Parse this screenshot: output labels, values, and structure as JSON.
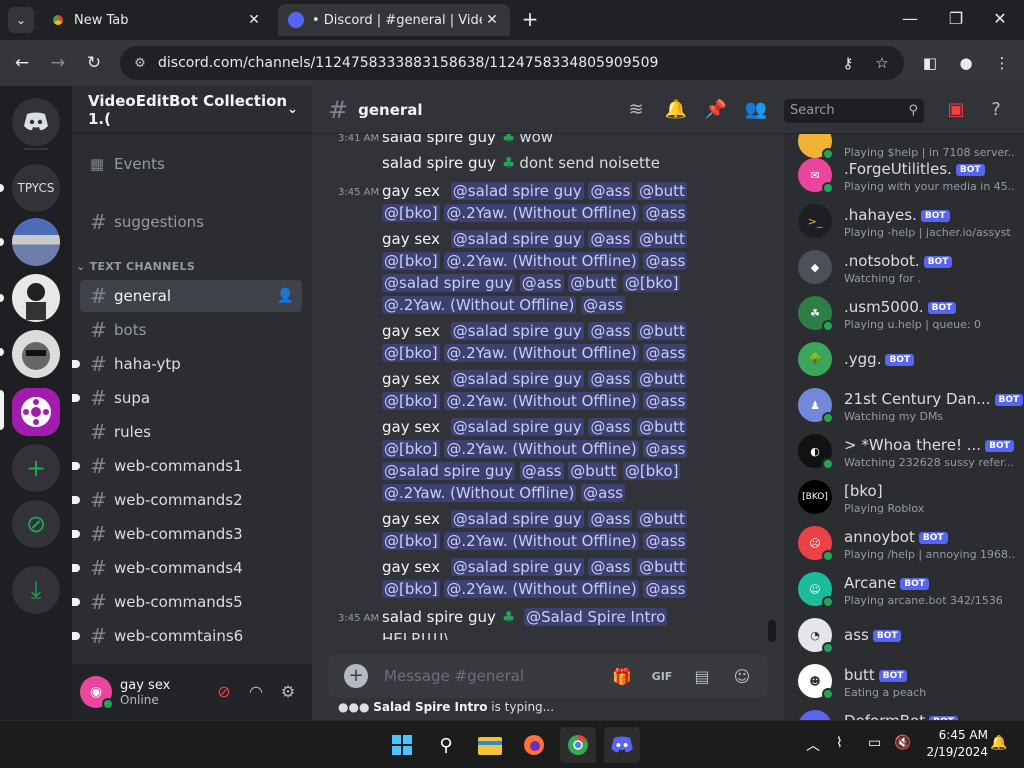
{
  "browser": {
    "tabs": [
      {
        "title": "New Tab",
        "active": false
      },
      {
        "title": "• Discord | #general | VideoEdit",
        "active": true
      }
    ],
    "url": "discord.com/channels/1124758333883158638/1124758334805909509"
  },
  "servers": [
    {
      "label": "TPYCS"
    }
  ],
  "guild": {
    "name": "VideoEditBot Collection 1.(",
    "events_label": "Events"
  },
  "channels": {
    "top": [
      {
        "name": "suggestions"
      }
    ],
    "category": "TEXT CHANNELS",
    "list": [
      {
        "name": "general"
      },
      {
        "name": "bots"
      },
      {
        "name": "haha-ytp"
      },
      {
        "name": "supa"
      },
      {
        "name": "rules"
      },
      {
        "name": "web-commands1"
      },
      {
        "name": "web-commands2"
      },
      {
        "name": "web-commands3"
      },
      {
        "name": "web-commands4"
      },
      {
        "name": "web-commands5"
      },
      {
        "name": "web-commtains6"
      }
    ]
  },
  "user": {
    "name": "gay sex",
    "status": "Online"
  },
  "channel_header": {
    "name": "general",
    "search_placeholder": "Search"
  },
  "messages": [
    {
      "time": "3:41 AM",
      "author": "salad spire guy",
      "text": "wow"
    },
    {
      "time": "",
      "author": "salad spire guy",
      "text": "dont send noisette"
    },
    {
      "time": "3:45 AM",
      "author": "gay sex",
      "mentions": [
        "@salad spire guy",
        "@ass",
        "@butt",
        "@[bko]",
        "@.2Yaw. (Without Offline)",
        "@ass"
      ]
    },
    {
      "time": "",
      "author": "gay sex",
      "mentions": [
        "@salad spire guy",
        "@ass",
        "@butt",
        "@[bko]",
        "@.2Yaw. (Without Offline)",
        "@ass",
        "@salad spire guy",
        "@ass",
        "@butt",
        "@[bko]",
        "@.2Yaw. (Without Offline)",
        "@ass"
      ]
    },
    {
      "time": "",
      "author": "gay sex",
      "mentions": [
        "@salad spire guy",
        "@ass",
        "@butt",
        "@[bko]",
        "@.2Yaw. (Without Offline)",
        "@ass"
      ]
    },
    {
      "time": "",
      "author": "gay sex",
      "mentions": [
        "@salad spire guy",
        "@ass",
        "@butt",
        "@[bko]",
        "@.2Yaw. (Without Offline)",
        "@ass"
      ]
    },
    {
      "time": "",
      "author": "gay sex",
      "mentions": [
        "@salad spire guy",
        "@ass",
        "@butt",
        "@[bko]",
        "@.2Yaw. (Without Offline)",
        "@ass",
        "@salad spire guy",
        "@ass",
        "@butt",
        "@[bko]",
        "@.2Yaw. (Without Offline)",
        "@ass"
      ]
    },
    {
      "time": "",
      "author": "gay sex",
      "mentions": [
        "@salad spire guy",
        "@ass",
        "@butt",
        "@[bko]",
        "@.2Yaw. (Without Offline)",
        "@ass"
      ]
    },
    {
      "time": "",
      "author": "gay sex",
      "mentions": [
        "@salad spire guy",
        "@ass",
        "@butt",
        "@[bko]",
        "@.2Yaw. (Without Offline)",
        "@ass"
      ]
    },
    {
      "time": "3:45 AM",
      "author": "salad spire guy",
      "mention": "@Salad Spire Intro",
      "text": "HELP!!!!\\"
    }
  ],
  "composer": {
    "placeholder": "Message #general"
  },
  "typing": {
    "who": "Salad Spire Intro",
    "suffix": "is typing..."
  },
  "members": [
    {
      "name": "",
      "activity": "Playing $help | in 7108 server...",
      "bot": false,
      "color": "#f0b232"
    },
    {
      "name": ".ForgeUtilitles.",
      "activity": "Playing with your media in 45...",
      "bot": true,
      "color": "#eb459e"
    },
    {
      "name": ".hahayes.",
      "activity": "Playing -help | jacher.io/assyst",
      "bot": true,
      "color": "#1e1f22"
    },
    {
      "name": ".notsobot.",
      "activity": "Watching for .",
      "bot": true,
      "color": "#4e5058"
    },
    {
      "name": ".usm5000.",
      "activity": "Playing u.help | queue: 0",
      "bot": true,
      "color": "#2d7d46"
    },
    {
      "name": ".ygg.",
      "activity": "",
      "bot": true,
      "color": "#3ba55c"
    },
    {
      "name": "21st Century Dan...",
      "activity": "Watching my DMs",
      "bot": true,
      "color": "#7289da"
    },
    {
      "name": "> *Whoa there! ...",
      "activity": "Watching 232628 sussy refer...",
      "bot": true,
      "color": "#111214"
    },
    {
      "name": "[bko]",
      "activity": "Playing Roblox",
      "bot": false,
      "color": "#000000"
    },
    {
      "name": "annoybot",
      "activity": "Playing /help | annoying 1968...",
      "bot": true,
      "color": "#ed4245"
    },
    {
      "name": "Arcane",
      "activity": "Playing arcane.bot 342/1536",
      "bot": true,
      "color": "#1abc9c"
    },
    {
      "name": "ass",
      "activity": "",
      "bot": true,
      "color": "#e3e5e8"
    },
    {
      "name": "butt",
      "activity": "Eating a peach",
      "bot": true,
      "color": "#ffffff"
    },
    {
      "name": "DeformBot",
      "activity": "",
      "bot": true,
      "color": "#5865f2"
    }
  ],
  "member_bot_label": "BOT",
  "taskbar": {
    "time": "6:45 AM",
    "date": "2/19/2024"
  },
  "colors": {
    "blurple": "#5865f2",
    "online": "#23a559",
    "mention_bg": "rgba(88,101,242,0.3)"
  }
}
